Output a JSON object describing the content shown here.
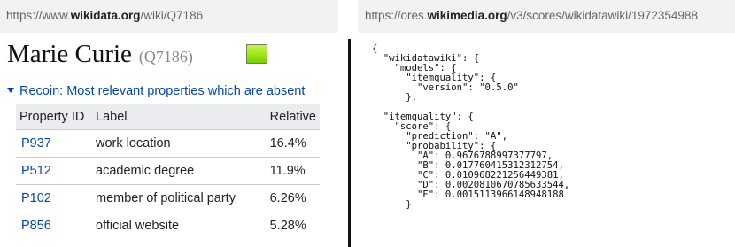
{
  "left": {
    "url": {
      "prefix": "https://www.",
      "domain": "wikidata.org",
      "path": "/wiki/Q7186"
    },
    "title": "Marie Curie",
    "qid": "(Q7186)",
    "quality_badge_color": "#9ae51a",
    "recoin_heading": "Recoin: Most relevant properties which are absent",
    "table": {
      "headers": [
        "Property ID",
        "Label",
        "Relative"
      ],
      "rows": [
        {
          "id": "P937",
          "label": "work location",
          "relative": "16.4%"
        },
        {
          "id": "P512",
          "label": "academic degree",
          "relative": "11.9%"
        },
        {
          "id": "P102",
          "label": "member of political party",
          "relative": "6.26%"
        },
        {
          "id": "P856",
          "label": "official website",
          "relative": "5.28%"
        }
      ]
    }
  },
  "right": {
    "url": {
      "prefix": "https://ores.",
      "domain": "wikimedia.org",
      "path": "/v3/scores/wikidatawiki/1972354988"
    },
    "json_lines": [
      "{",
      "  \"wikidatawiki\": {",
      "    \"models\": {",
      "      \"itemquality\": {",
      "        \"version\": \"0.5.0\"",
      "      },",
      "",
      "  \"itemquality\": {",
      "    \"score\": {",
      "      \"prediction\": \"A\",",
      "      \"probability\": {",
      "        \"A\": 0.9676788997377797,",
      "        \"B\": 0.017760415312312754,",
      "        \"C\": 0.010968221256449381,",
      "        \"D\": 0.0020810670785633544,",
      "        \"E\": 0.0015113966148948188",
      "      }"
    ]
  }
}
